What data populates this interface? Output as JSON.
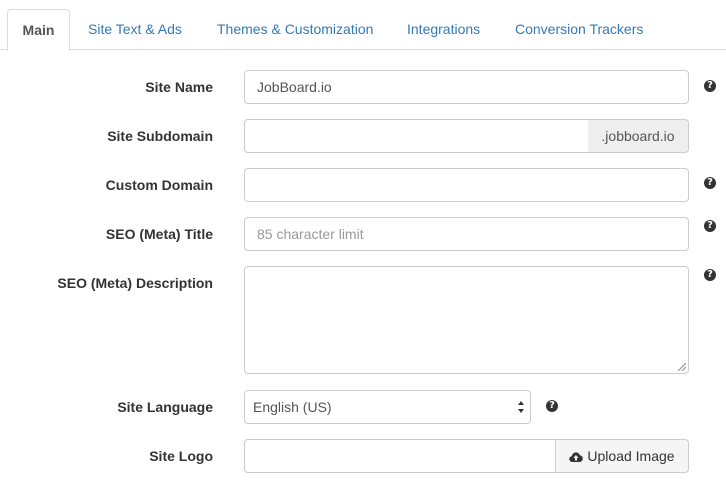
{
  "tabs": [
    {
      "label": "Main",
      "active": true
    },
    {
      "label": "Site Text & Ads",
      "active": false
    },
    {
      "label": "Themes & Customization",
      "active": false
    },
    {
      "label": "Integrations",
      "active": false
    },
    {
      "label": "Conversion Trackers",
      "active": false
    }
  ],
  "form": {
    "site_name": {
      "label": "Site Name",
      "value": "JobBoard.io",
      "help_icon": "question-circle-icon"
    },
    "site_subdomain": {
      "label": "Site Subdomain",
      "value": "",
      "addon": ".jobboard.io"
    },
    "custom_domain": {
      "label": "Custom Domain",
      "value": "",
      "help_icon": "question-circle-icon"
    },
    "seo_title": {
      "label": "SEO (Meta) Title",
      "value": "",
      "placeholder": "85 character limit",
      "help_icon": "question-circle-icon"
    },
    "seo_description": {
      "label": "SEO (Meta) Description",
      "value": "",
      "help_icon": "question-circle-icon"
    },
    "site_language": {
      "label": "Site Language",
      "selected": "English (US)",
      "help_icon": "question-circle-icon"
    },
    "site_logo": {
      "label": "Site Logo",
      "value": "",
      "button_label": "Upload Image",
      "button_icon": "cloud-upload-icon"
    }
  },
  "colors": {
    "link": "#337ab7",
    "border": "#cccccc",
    "addon_bg": "#eeeeee",
    "label": "#333333"
  }
}
